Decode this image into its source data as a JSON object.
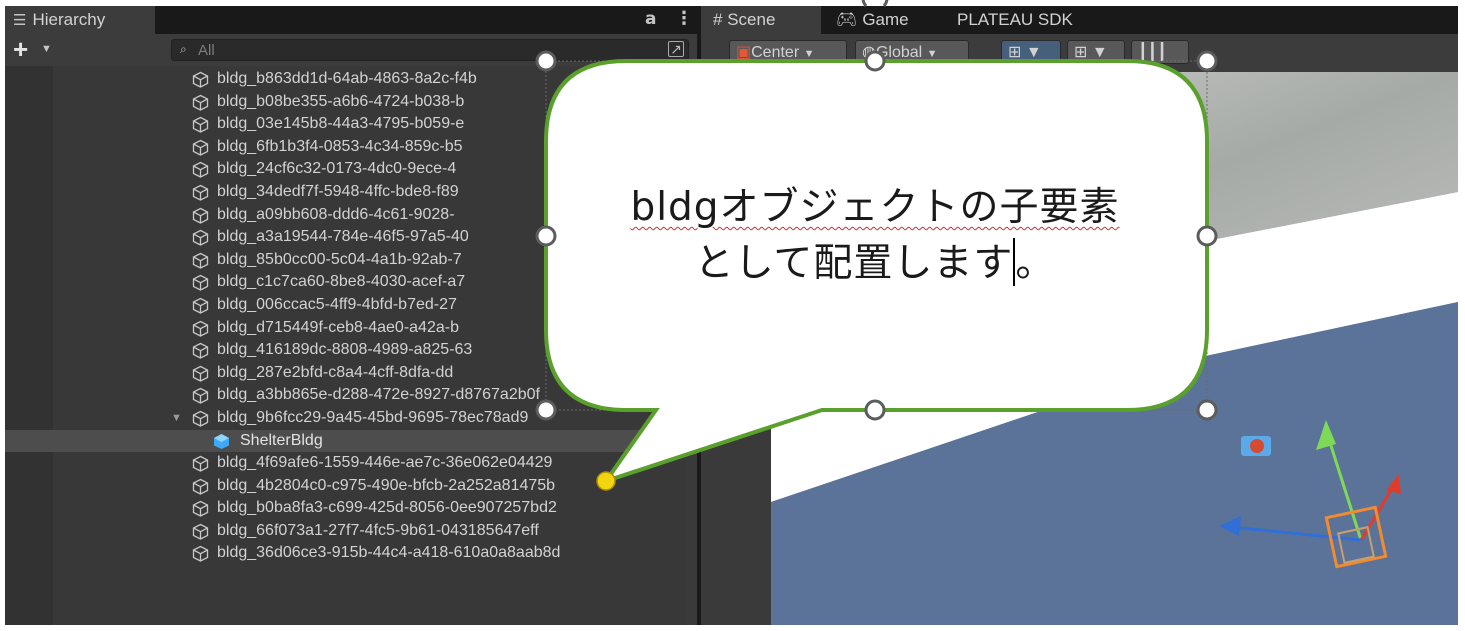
{
  "hierarchy": {
    "tab_label": "Hierarchy",
    "tab_icon": "list-icon",
    "search_placeholder": "All",
    "add_label": "+",
    "rows": [
      {
        "name": "bldg_b863dd1d-64ab-4863-8a2c-f4b"
      },
      {
        "name": "bldg_b08be355-a6b6-4724-b038-b"
      },
      {
        "name": "bldg_03e145b8-44a3-4795-b059-e"
      },
      {
        "name": "bldg_6fb1b3f4-0853-4c34-859c-b5"
      },
      {
        "name": "bldg_24cf6c32-0173-4dc0-9ece-4"
      },
      {
        "name": "bldg_34dedf7f-5948-4ffc-bde8-f89"
      },
      {
        "name": "bldg_a09bb608-ddd6-4c61-9028-"
      },
      {
        "name": "bldg_a3a19544-784e-46f5-97a5-40"
      },
      {
        "name": "bldg_85b0cc00-5c04-4a1b-92ab-7"
      },
      {
        "name": "bldg_c1c7ca60-8be8-4030-acef-a7"
      },
      {
        "name": "bldg_006ccac5-4ff9-4bfd-b7ed-27"
      },
      {
        "name": "bldg_d715449f-ceb8-4ae0-a42a-b"
      },
      {
        "name": "bldg_416189dc-8808-4989-a825-63"
      },
      {
        "name": "bldg_287e2bfd-c8a4-4cff-8dfa-dd"
      },
      {
        "name": "bldg_a3bb865e-d288-472e-8927-d8767a2b0f"
      },
      {
        "name": "bldg_9b6fcc29-9a45-45bd-9695-78ec78ad9",
        "expanded": true
      },
      {
        "name": "ShelterBldg",
        "selected": true,
        "prefab": true
      },
      {
        "name": "bldg_4f69afe6-1559-446e-ae7c-36e062e04429"
      },
      {
        "name": "bldg_4b2804c0-c975-490e-bfcb-2a252a81475b"
      },
      {
        "name": "bldg_b0ba8fa3-c699-425d-8056-0ee907257bd2"
      },
      {
        "name": "bldg_66f073a1-27f7-4fc5-9b61-043185647eff"
      },
      {
        "name": "bldg_36d06ce3-915b-44c4-a418-610a0a8aab8d"
      }
    ]
  },
  "scene": {
    "tabs": [
      "Scene",
      "Game",
      "PLATEAU SDK"
    ],
    "pivot_label": "Center",
    "space_label": "Global"
  },
  "callout": {
    "line1": "bldgオブジェクトの子要素",
    "line2": "として配置します",
    "line2_end": "。"
  },
  "colors": {
    "callout_border": "#5aa02c",
    "prefab_cube": "#3fa9f5",
    "selection_dot": "#f2d40f",
    "gizmo_y": "#7ed957",
    "gizmo_x": "#e03c2c",
    "gizmo_z": "#2f6fd6"
  }
}
